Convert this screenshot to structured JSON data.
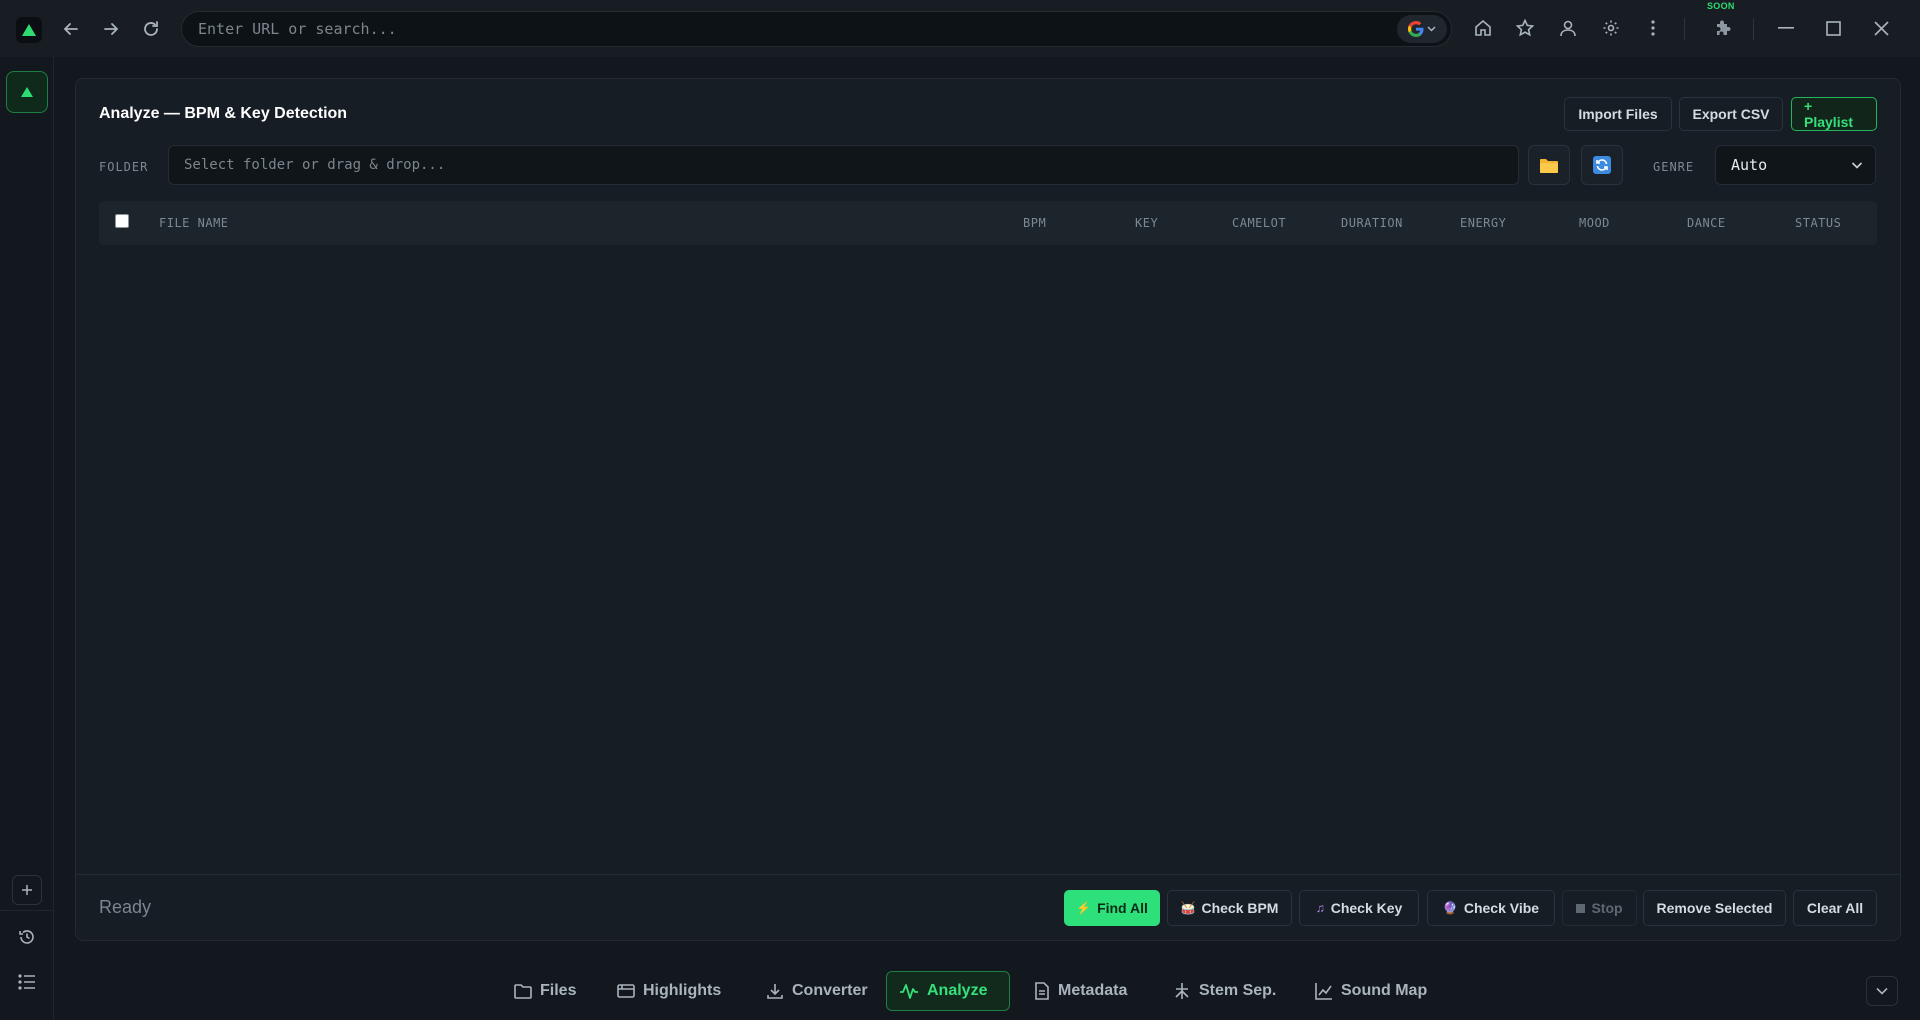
{
  "topbar": {
    "url_placeholder": "Enter URL or search...",
    "search_engine": "google-icon",
    "soon_badge": "SOON"
  },
  "panel": {
    "title": "Analyze — BPM & Key Detection",
    "buttons": {
      "import": "Import Files",
      "export": "Export CSV",
      "playlist": "+ Playlist"
    },
    "folder_label": "FOLDER",
    "folder_placeholder": "Select folder or drag & drop...",
    "genre_label": "GENRE",
    "genre_value": "Auto"
  },
  "table": {
    "columns": [
      "FILE NAME",
      "BPM",
      "KEY",
      "CAMELOT",
      "DURATION",
      "ENERGY",
      "MOOD",
      "DANCE",
      "STATUS"
    ],
    "rows": []
  },
  "footer": {
    "status": "Ready",
    "actions": {
      "find_all": "Find All",
      "check_bpm": "Check BPM",
      "check_key": "Check Key",
      "check_vibe": "Check Vibe",
      "stop": "Stop",
      "remove_selected": "Remove Selected",
      "clear_all": "Clear All"
    }
  },
  "bottom_nav": {
    "items": [
      {
        "label": "Files",
        "icon": "folder-icon"
      },
      {
        "label": "Highlights",
        "icon": "window-icon"
      },
      {
        "label": "Converter",
        "icon": "download-icon"
      },
      {
        "label": "Analyze",
        "icon": "waveform-icon",
        "active": true
      },
      {
        "label": "Metadata",
        "icon": "document-icon"
      },
      {
        "label": "Stem Sep.",
        "icon": "split-icon"
      },
      {
        "label": "Sound Map",
        "icon": "scatter-icon"
      }
    ]
  },
  "colors": {
    "accent": "#2ee07a",
    "background": "#12181e",
    "panel": "#161d24"
  }
}
